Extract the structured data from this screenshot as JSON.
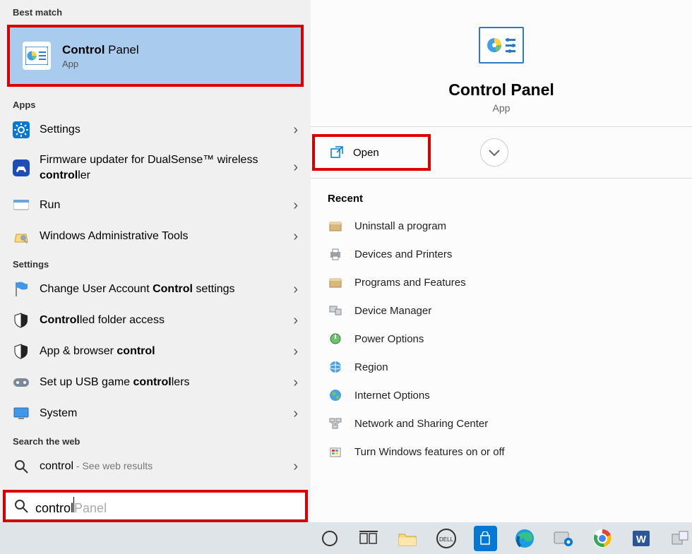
{
  "sections": {
    "best_match": "Best match",
    "apps": "Apps",
    "settings": "Settings",
    "web": "Search the web"
  },
  "best_match": {
    "title_bold": "Control",
    "title_rest": " Panel",
    "sub": "App"
  },
  "apps": [
    {
      "label_plain": "Settings",
      "icon": "gear"
    },
    {
      "pre": "Firmware updater for DualSense™ wireless ",
      "bold": "control",
      "post": "ler",
      "icon": "dualsense"
    },
    {
      "label_plain": "Run",
      "icon": "run"
    },
    {
      "label_plain": "Windows Administrative Tools",
      "icon": "tools"
    }
  ],
  "settings_list": [
    {
      "pre": "Change User Account ",
      "bold": "Control",
      "post": " settings",
      "icon": "flag"
    },
    {
      "bold": "Control",
      "post": "led folder access",
      "icon": "shield"
    },
    {
      "pre": "App & browser ",
      "bold": "control",
      "icon": "shield"
    },
    {
      "pre": "Set up USB game ",
      "bold": "control",
      "post": "lers",
      "icon": "usbgame"
    },
    {
      "label_plain": "System",
      "icon": "monitor"
    }
  ],
  "web": {
    "query": "control",
    "suffix": " - See web results"
  },
  "search": {
    "typed": "control",
    "ghost": " Panel"
  },
  "preview": {
    "title": "Control Panel",
    "sub": "App",
    "open": "Open"
  },
  "recent_header": "Recent",
  "recent": [
    "Uninstall a program",
    "Devices and Printers",
    "Programs and Features",
    "Device Manager",
    "Power Options",
    "Region",
    "Internet Options",
    "Network and Sharing Center",
    "Turn Windows features on or off"
  ]
}
